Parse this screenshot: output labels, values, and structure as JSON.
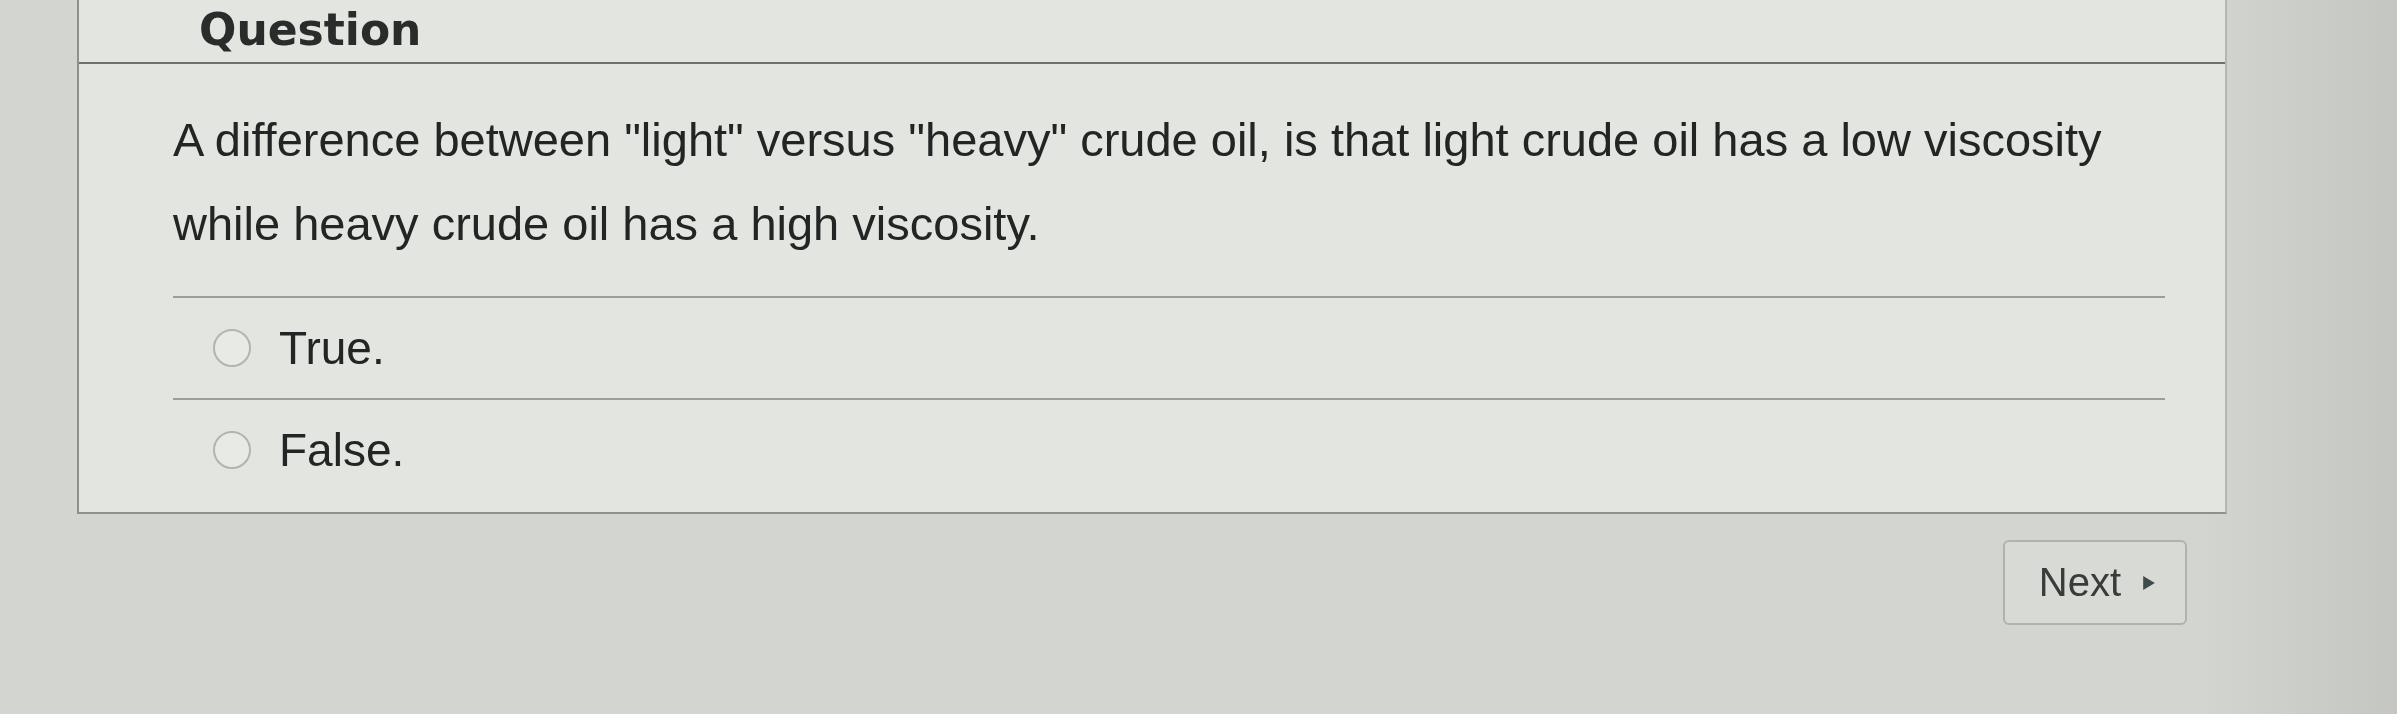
{
  "header": {
    "title": "Question"
  },
  "question": {
    "text": "A difference between \"light\" versus \"heavy\" crude oil, is that light crude oil has a low viscosity while heavy crude oil has a high viscosity."
  },
  "options": [
    {
      "label": "True.",
      "selected": false
    },
    {
      "label": "False.",
      "selected": false
    }
  ],
  "next_button": {
    "label": "Next"
  }
}
